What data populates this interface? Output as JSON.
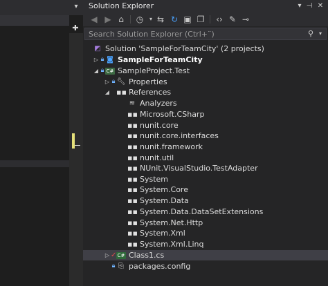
{
  "panel_title": "Solution Explorer",
  "search_placeholder": "Search Solution Explorer (Ctrl+¨)",
  "tree": [
    {
      "label": "Solution 'SampleForTeamCity' (2 projects)",
      "icon": "solution-icon",
      "bold": false
    },
    {
      "label": "SampleForTeamCity",
      "icon": "web-project-icon",
      "bold": true
    },
    {
      "label": "SampleProject.Test",
      "icon": "csharp-project-icon",
      "bold": false
    },
    {
      "label": "Properties",
      "icon": "wrench-icon",
      "bold": false
    },
    {
      "label": "References",
      "icon": "references-icon",
      "bold": false
    },
    {
      "label": "Analyzers",
      "icon": "analyzers-icon",
      "bold": false
    },
    {
      "label": "Microsoft.CSharp",
      "icon": "reference-icon",
      "bold": false
    },
    {
      "label": "nunit.core",
      "icon": "reference-icon",
      "bold": false
    },
    {
      "label": "nunit.core.interfaces",
      "icon": "reference-icon",
      "bold": false
    },
    {
      "label": "nunit.framework",
      "icon": "reference-icon",
      "bold": false
    },
    {
      "label": "nunit.util",
      "icon": "reference-icon",
      "bold": false
    },
    {
      "label": "NUnit.VisualStudio.TestAdapter",
      "icon": "reference-icon",
      "bold": false
    },
    {
      "label": "System",
      "icon": "reference-icon",
      "bold": false
    },
    {
      "label": "System.Core",
      "icon": "reference-icon",
      "bold": false
    },
    {
      "label": "System.Data",
      "icon": "reference-icon",
      "bold": false
    },
    {
      "label": "System.Data.DataSetExtensions",
      "icon": "reference-icon",
      "bold": false
    },
    {
      "label": "System.Net.Http",
      "icon": "reference-icon",
      "bold": false
    },
    {
      "label": "System.Xml",
      "icon": "reference-icon",
      "bold": false
    },
    {
      "label": "System.Xml.Linq",
      "icon": "reference-icon",
      "bold": false
    },
    {
      "label": "Class1.cs",
      "icon": "csharp-file-icon",
      "bold": false,
      "selected": true
    },
    {
      "label": "packages.config",
      "icon": "config-file-icon",
      "bold": false
    }
  ],
  "toolbar": {
    "back": "back-icon",
    "forward": "forward-icon",
    "home": "home-icon",
    "history": "history-icon",
    "sync": "sync-icon",
    "refresh": "refresh-icon",
    "collapse": "collapse-all-icon",
    "show_all": "show-all-files-icon",
    "code": "view-code-icon",
    "properties": "properties-icon",
    "preview": "preview-icon"
  },
  "colors": {
    "background": "#252526",
    "selection": "#3f3f46",
    "accent": "#4aa3ff"
  }
}
